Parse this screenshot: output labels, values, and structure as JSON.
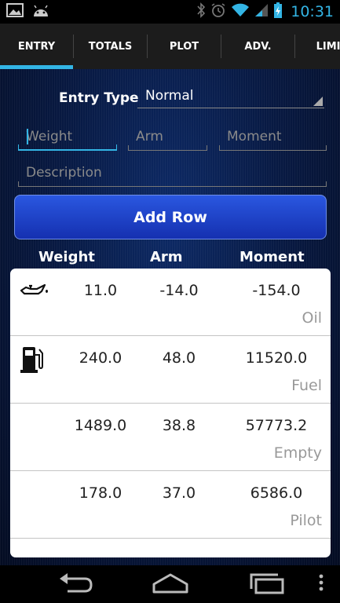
{
  "status_bar": {
    "clock": "10:31",
    "icons": [
      "gallery-icon",
      "android-icon",
      "bluetooth-icon",
      "alarm-icon",
      "wifi-icon",
      "signal-icon",
      "battery-charging-icon"
    ]
  },
  "tabs": [
    {
      "label": "ENTRY",
      "active": true
    },
    {
      "label": "TOTALS",
      "active": false
    },
    {
      "label": "PLOT",
      "active": false
    },
    {
      "label": "ADV.",
      "active": false
    },
    {
      "label": "LIMIT",
      "active": false
    }
  ],
  "form": {
    "entry_type_label": "Entry Type",
    "entry_type_value": "Normal",
    "weight_placeholder": "Weight",
    "arm_placeholder": "Arm",
    "moment_placeholder": "Moment",
    "description_placeholder": "Description",
    "add_row_label": "Add Row"
  },
  "columns": {
    "weight": "Weight",
    "arm": "Arm",
    "moment": "Moment"
  },
  "rows": [
    {
      "icon": "oil-can-icon",
      "weight": "11.0",
      "arm": "-14.0",
      "moment": "-154.0",
      "description": "Oil"
    },
    {
      "icon": "fuel-pump-icon",
      "weight": "240.0",
      "arm": "48.0",
      "moment": "11520.0",
      "description": "Fuel"
    },
    {
      "icon": "",
      "weight": "1489.0",
      "arm": "38.8",
      "moment": "57773.2",
      "description": "Empty"
    },
    {
      "icon": "",
      "weight": "178.0",
      "arm": "37.0",
      "moment": "6586.0",
      "description": "Pilot"
    }
  ],
  "colors": {
    "accent": "#33b5e5",
    "button_top": "#2a57e0",
    "button_bottom": "#1530b0"
  },
  "nav": [
    "back-icon",
    "home-icon",
    "recent-apps-icon",
    "overflow-menu-icon"
  ]
}
